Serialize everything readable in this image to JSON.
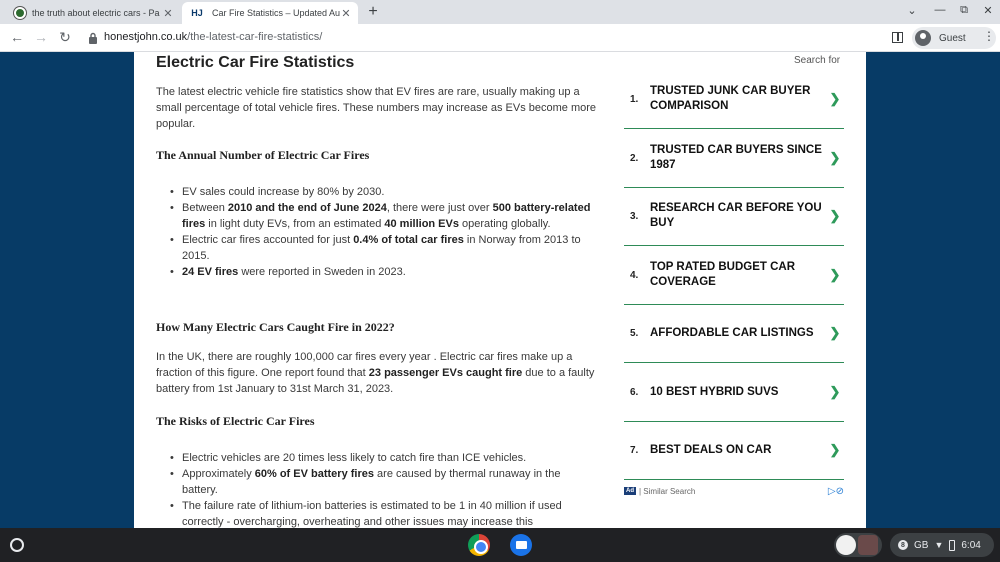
{
  "browser": {
    "tabs": [
      {
        "title": "the truth about electric cars - Pa",
        "favicon": "green-circle-icon"
      },
      {
        "title": "Car Fire Statistics – Updated Au",
        "favicon_text": "HJ"
      }
    ],
    "new_tab": "+",
    "url_domain": "honestjohn.co.uk",
    "url_path": "/the-latest-car-fire-statistics/",
    "profile_label": "Guest"
  },
  "article": {
    "title": "Electric Car Fire Statistics",
    "intro": "The latest electric vehicle fire statistics show that EV fires are rare, usually making up a small percentage of total vehicle fires. These numbers may increase as EVs become more popular.",
    "sections": [
      {
        "heading": "The Annual Number of Electric Car Fires",
        "bullets": [
          "EV sales could increase by 80% by 2030.",
          "Between <b>2010 and the end of June 2024</b>, there were just over <b>500 battery-related fires</b> in light duty EVs, from an estimated <b>40 million EVs</b> operating globally.",
          "Electric car fires accounted for just <b>0.4% of total car fires</b> in Norway from 2013 to 2015.",
          "<b>24 EV fires</b> were reported in Sweden in 2023."
        ]
      },
      {
        "heading": "How Many Electric Cars Caught Fire in 2022?",
        "paragraph": "In the UK, there are roughly 100,000 car fires every year . Electric car fires make up a fraction of this figure. One report found that <b>23 passenger EVs caught fire</b> due to a faulty battery from 1st January to 31st March 31, 2023."
      },
      {
        "heading": "The Risks of Electric Car Fires",
        "bullets": [
          "Electric vehicles are 20 times less likely to catch fire than ICE vehicles.",
          "Approximately <b>60% of EV battery fires</b> are caused by thermal runaway in the battery.",
          "The failure rate of lithium-ion batteries is estimated to be 1 in 40 million if used correctly - overcharging, overheating and other issues may increase this"
        ]
      }
    ]
  },
  "sidebar": {
    "search_for": "Search for",
    "ads": [
      {
        "num": "1.",
        "label": "TRUSTED JUNK CAR BUYER COMPARISON"
      },
      {
        "num": "2.",
        "label": "TRUSTED CAR BUYERS SINCE 1987"
      },
      {
        "num": "3.",
        "label": "RESEARCH CAR BEFORE YOU BUY"
      },
      {
        "num": "4.",
        "label": "TOP RATED BUDGET CAR COVERAGE"
      },
      {
        "num": "5.",
        "label": "AFFORDABLE CAR LISTINGS"
      },
      {
        "num": "6.",
        "label": "10 BEST HYBRID SUVS"
      },
      {
        "num": "7.",
        "label": "BEST DEALS ON CAR"
      }
    ],
    "ad_badge": "Ad",
    "ad_footer": "| Similar Search",
    "accent_color": "#2e8b57"
  },
  "shelf": {
    "locale": "GB",
    "time": "6:04"
  }
}
